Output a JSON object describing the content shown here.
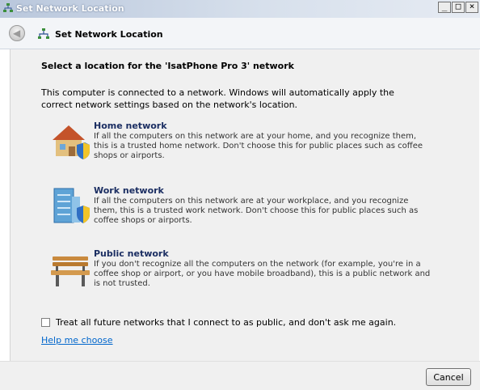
{
  "window": {
    "title": "Set Network Location",
    "caption_buttons": [
      "_",
      "□",
      "×"
    ]
  },
  "nav": {
    "title": "Set Network Location",
    "back_icon": "back-arrow-icon"
  },
  "main": {
    "heading": "Select a location for the 'IsatPhone Pro  3' network",
    "intro": "This computer is connected to a network. Windows will automatically apply the correct network settings based on the network's location."
  },
  "options": [
    {
      "title": "Home network",
      "description": "If all the computers on this network are at your home, and you recognize them, this is a trusted home network.  Don't choose this for public places such as coffee shops or airports.",
      "icon": "house-shield-icon"
    },
    {
      "title": "Work network",
      "description": "If all the computers on this network are at your workplace, and you recognize them, this is a trusted work network.  Don't choose this for public places such as coffee shops or airports.",
      "icon": "office-shield-icon"
    },
    {
      "title": "Public network",
      "description": "If you don't recognize all the computers on the network (for example, you're in a coffee shop or airport, or you have mobile broadband), this is a public network and is not trusted.",
      "icon": "park-bench-icon"
    }
  ],
  "checkbox": {
    "label": "Treat all future networks that I connect to as public, and don't ask me again.",
    "checked": false
  },
  "help_link": "Help me choose",
  "footer": {
    "cancel_label": "Cancel"
  },
  "colors": {
    "title_blue": "#1b2e62",
    "link_blue": "#0066cc",
    "content_bg": "#f0f0f0"
  }
}
